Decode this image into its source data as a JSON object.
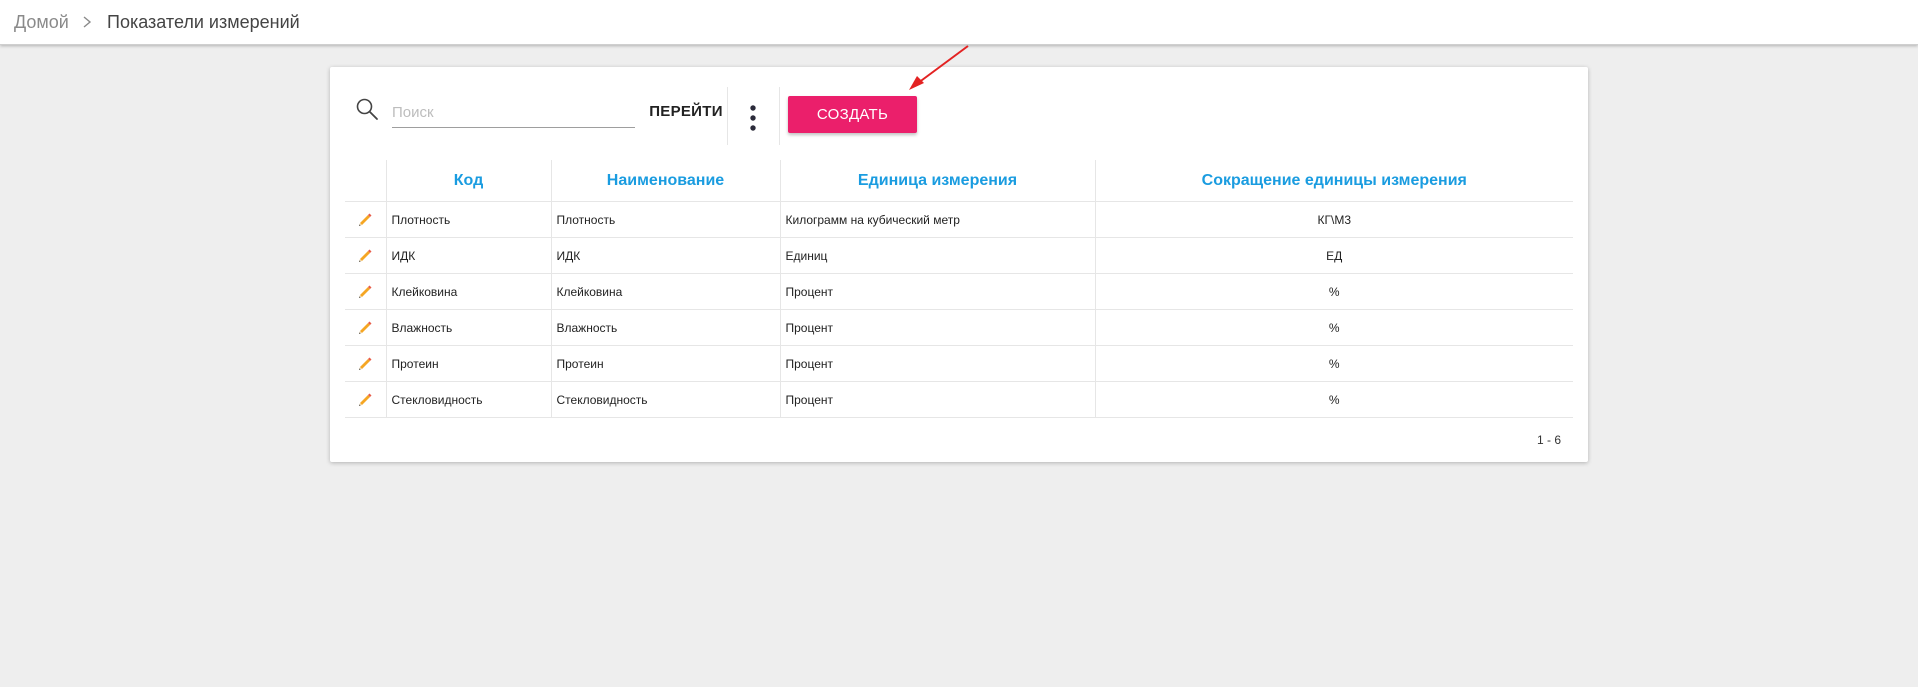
{
  "breadcrumb": {
    "home": "Домой",
    "current": "Показатели измерений"
  },
  "toolbar": {
    "search_placeholder": "Поиск",
    "search_value": "",
    "go_label": "ПЕРЕЙТИ",
    "create_label": "СОЗДАТЬ"
  },
  "table": {
    "headers": [
      "Код",
      "Наименование",
      "Единица измерения",
      "Сокращение единицы измерения"
    ],
    "rows": [
      {
        "code": "Плотность",
        "name": "Плотность",
        "unit": "Килограмм на кубический метр",
        "abbr": "КГ\\М3"
      },
      {
        "code": "ИДК",
        "name": "ИДК",
        "unit": "Единиц",
        "abbr": "ЕД"
      },
      {
        "code": "Клейковина",
        "name": "Клейковина",
        "unit": "Процент",
        "abbr": "%"
      },
      {
        "code": "Влажность",
        "name": "Влажность",
        "unit": "Процент",
        "abbr": "%"
      },
      {
        "code": "Протеин",
        "name": "Протеин",
        "unit": "Процент",
        "abbr": "%"
      },
      {
        "code": "Стекловидность",
        "name": "Стекловидность",
        "unit": "Процент",
        "abbr": "%"
      }
    ]
  },
  "pagination": {
    "range": "1 - 6"
  },
  "icons": {
    "breadcrumb_separator": "chevron-right-icon",
    "search": "search-icon",
    "more": "more-vertical-icon",
    "edit": "pencil-icon",
    "annotation": "red-arrow"
  },
  "colors": {
    "accent": "#eb1f6b",
    "header_text": "#1a9ce0",
    "annotation_arrow": "#e32222",
    "background": "#eeeeee"
  }
}
